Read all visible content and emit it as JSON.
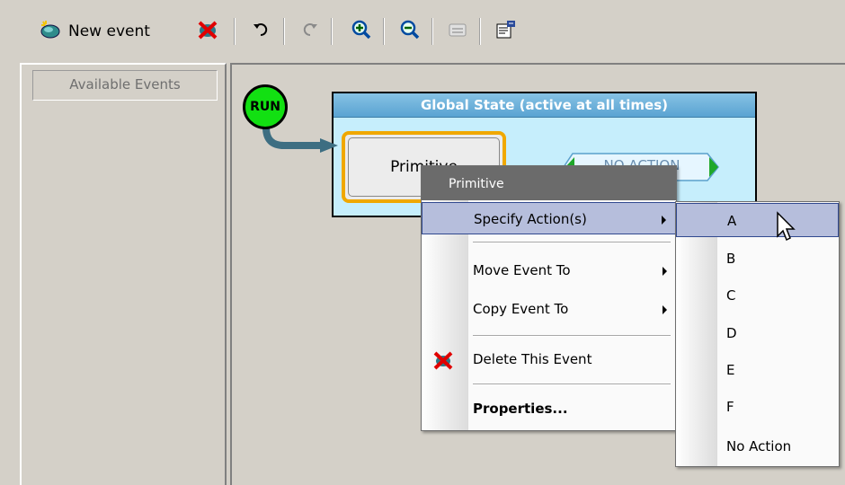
{
  "toolbar": {
    "new_event_label": "New event",
    "icons": [
      "new-event-icon",
      "delete-icon",
      "undo-icon",
      "redo-icon",
      "zoom-in-icon",
      "zoom-out-icon",
      "keyboard-icon",
      "properties-icon"
    ]
  },
  "left_panel": {
    "available_events_label": "Available Events"
  },
  "canvas": {
    "run_label": "RUN",
    "global_state_title": "Global State (active at all times)",
    "event_label": "Primitive",
    "no_action_label": "NO ACTION"
  },
  "context_menu": {
    "header": "Primitive",
    "items": [
      {
        "label": "Specify Action(s)",
        "submenu": true,
        "selected": true
      },
      {
        "label": "Move Event To",
        "submenu": true
      },
      {
        "label": "Copy Event To",
        "submenu": true
      },
      {
        "label": "Delete This Event",
        "icon": "delete-icon"
      },
      {
        "label": "Properties...",
        "bold": true
      }
    ]
  },
  "submenu": {
    "items": [
      "A",
      "B",
      "C",
      "D",
      "E",
      "F",
      "No Action"
    ],
    "selected": "A"
  },
  "colors": {
    "run_green": "#12e012",
    "global_state_bg": "#c6eefc",
    "event_border": "#f0a800",
    "menu_selection": "#b6bedc"
  }
}
